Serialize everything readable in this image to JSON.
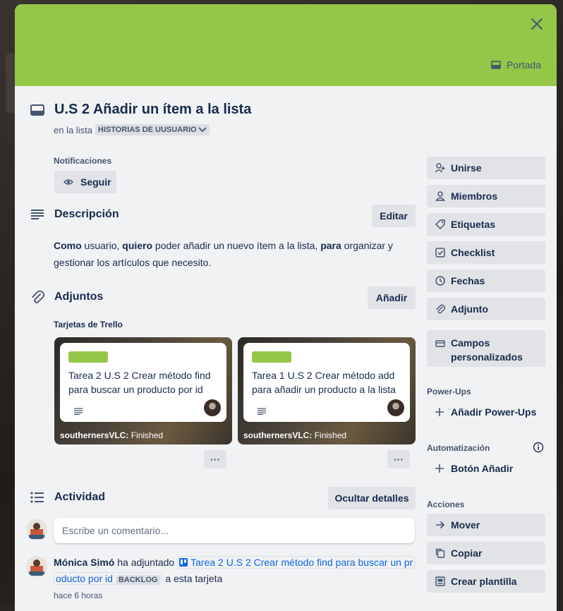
{
  "cover": {
    "color": "#94c748",
    "portada_label": "Portada"
  },
  "card": {
    "title": "U.S 2 Añadir un ítem a la lista",
    "in_list_prefix": "en la lista",
    "list_name": "HISTORIAS DE UUSUARIO"
  },
  "notifications": {
    "label": "Notificaciones",
    "follow_label": "Seguir"
  },
  "description": {
    "title": "Descripción",
    "edit_label": "Editar",
    "parts": [
      "Como",
      " usuario, ",
      "quiero",
      " poder añadir un nuevo ítem a la lista, ",
      "para",
      " organizar y gestionar los artículos que necesito."
    ]
  },
  "attachments": {
    "title": "Adjuntos",
    "add_label": "Añadir",
    "subheading": "Tarjetas de Trello",
    "cards": [
      {
        "name": "Tarea 2 U.S 2 Crear método find para buscar un producto por id",
        "board": "southernersVLC:",
        "list": "Finished",
        "more": "···"
      },
      {
        "name": "Tarea 1 U.S 2 Crear método add para añadir un producto a la lista",
        "board": "southernersVLC:",
        "list": "Finished",
        "more": "···"
      }
    ]
  },
  "activity": {
    "title": "Actividad",
    "hide_details_label": "Ocultar detalles",
    "comment_placeholder": "Escribe un comentario...",
    "entries": [
      {
        "user": "Mónica Simó",
        "action": "ha adjuntado",
        "link_text_1": "Tarea 2 U.S 2 Crear método find para buscar un pr",
        "link_text_2": "oducto por id",
        "badge": "BACKLOG",
        "suffix": "a esta tarjeta",
        "time": "hace 6 horas"
      }
    ]
  },
  "sidebar": {
    "buttons": [
      {
        "label": "Unirse",
        "icon": "user-plus-icon"
      },
      {
        "label": "Miembros",
        "icon": "user-icon"
      },
      {
        "label": "Etiquetas",
        "icon": "tag-icon"
      },
      {
        "label": "Checklist",
        "icon": "checkbox-icon"
      },
      {
        "label": "Fechas",
        "icon": "clock-icon"
      },
      {
        "label": "Adjunto",
        "icon": "paperclip-icon"
      },
      {
        "label_1": "Campos",
        "label_2": "personalizados",
        "icon": "custom-fields-icon"
      }
    ],
    "powerups_heading": "Power-Ups",
    "add_powerups_label": "Añadir Power-Ups",
    "automation_heading": "Automatización",
    "add_button_label": "Botón Añadir",
    "actions_heading": "Acciones",
    "actions": [
      {
        "label": "Mover",
        "icon": "arrow-right-icon"
      },
      {
        "label": "Copiar",
        "icon": "copy-icon"
      },
      {
        "label": "Crear plantilla",
        "icon": "template-icon"
      }
    ]
  }
}
